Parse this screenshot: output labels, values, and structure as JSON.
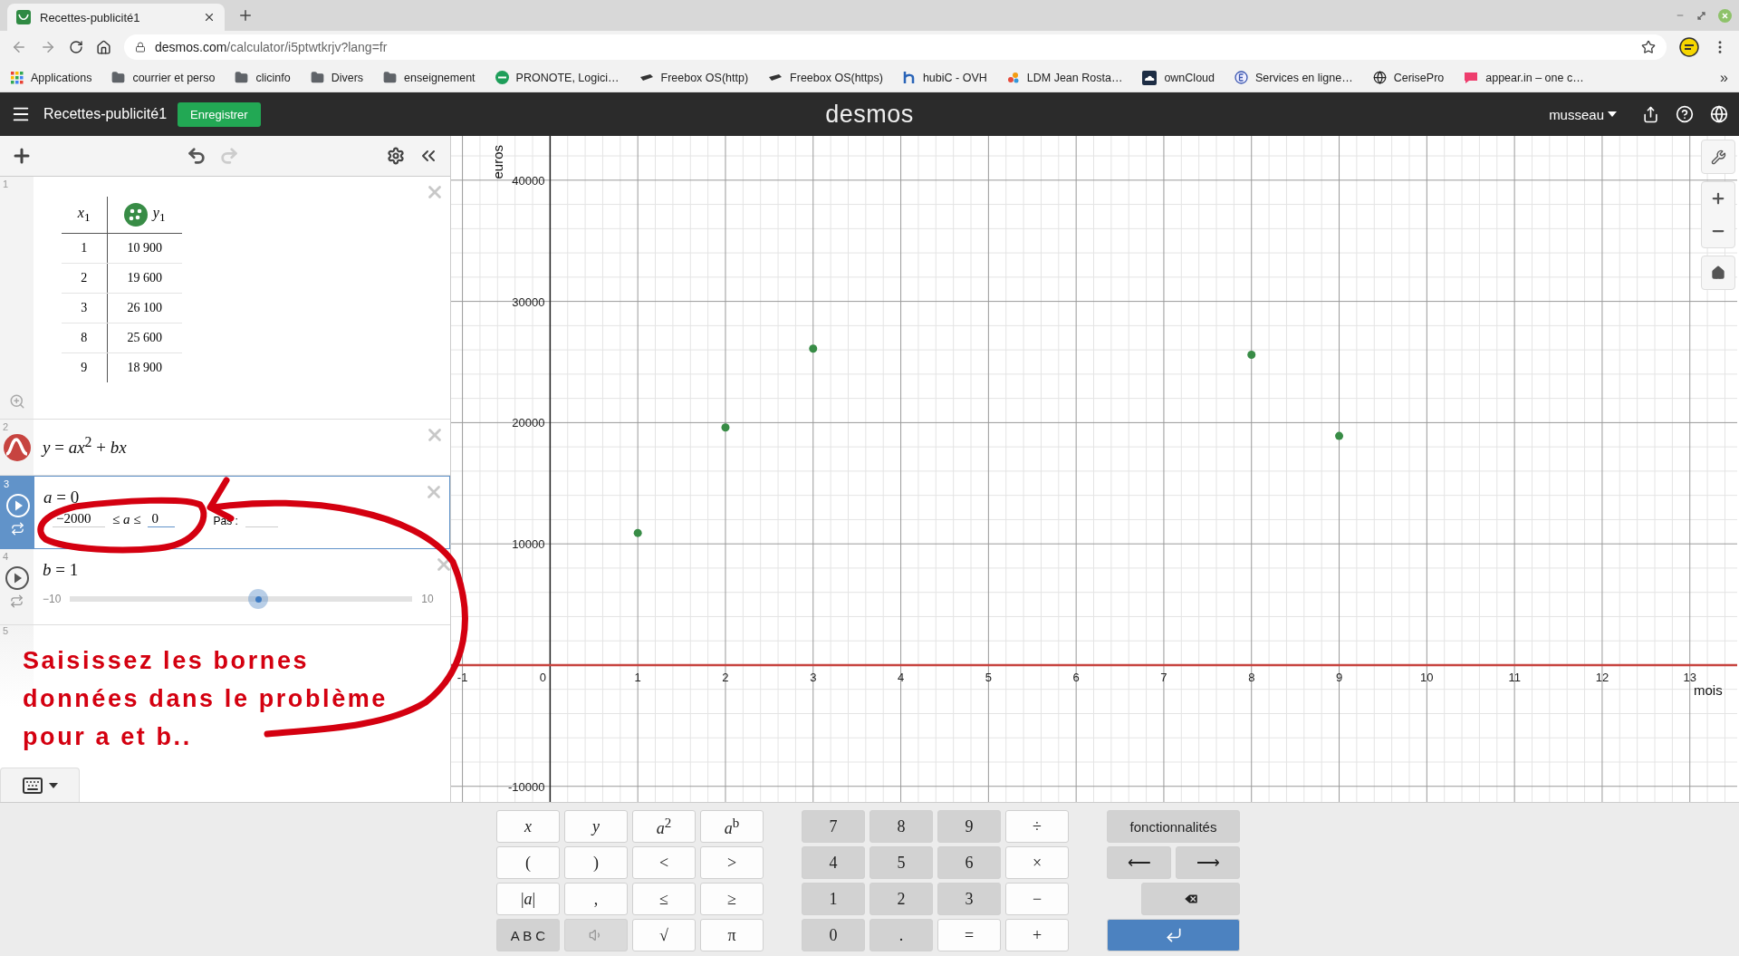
{
  "browser": {
    "tab": {
      "title": "Recettes-publicité1"
    },
    "url": {
      "host": "desmos.com",
      "path": "/calculator/i5ptwtkrjv?lang=fr"
    },
    "bookmarks": [
      {
        "label": "Applications",
        "kind": "apps"
      },
      {
        "label": "courrier et perso",
        "kind": "folder"
      },
      {
        "label": "clicinfo",
        "kind": "folder"
      },
      {
        "label": "Divers",
        "kind": "folder"
      },
      {
        "label": "enseignement",
        "kind": "folder"
      },
      {
        "label": "PRONOTE, Logici…",
        "kind": "badge"
      },
      {
        "label": "Freebox OS(http)",
        "kind": "device"
      },
      {
        "label": "Freebox OS(https)",
        "kind": "device"
      },
      {
        "label": "hubiC - OVH",
        "kind": "hook"
      },
      {
        "label": "LDM Jean Rosta…",
        "kind": "dots"
      },
      {
        "label": "ownCloud",
        "kind": "cloud"
      },
      {
        "label": "Services en ligne…",
        "kind": "ring"
      },
      {
        "label": "CerisePro",
        "kind": "globe"
      },
      {
        "label": "appear.in – one c…",
        "kind": "chat"
      }
    ],
    "overflow": "»"
  },
  "header": {
    "title": "Recettes-publicité1",
    "save": "Enregistrer",
    "logo": "desmos",
    "user": "musseau"
  },
  "expressions": [
    {
      "number": "1",
      "kind": "table",
      "color": "#388c46",
      "selected": false,
      "columns": [
        "*x*$_{1}$",
        "*y*$_{1}$"
      ],
      "rows": [
        [
          "1",
          "10 900"
        ],
        [
          "2",
          "19 600"
        ],
        [
          "3",
          "26 100"
        ],
        [
          "8",
          "25 600"
        ],
        [
          "9",
          "18 900"
        ]
      ]
    },
    {
      "number": "2",
      "kind": "formula",
      "color": "#c74440",
      "selected": false,
      "text": "*y* = *ax*$^{2}$ + *bx*"
    },
    {
      "number": "3",
      "kind": "slider",
      "selected": true,
      "expanded": true,
      "text": "*a* = 0",
      "min": "−2000",
      "relation": "≤ *a* ≤",
      "max": "0",
      "step_label": "Pas :"
    },
    {
      "number": "4",
      "kind": "slider",
      "selected": false,
      "expanded": false,
      "text": "*b* = 1",
      "min": "−10",
      "max": "10",
      "level": 0.55
    },
    {
      "number": "5",
      "kind": "empty",
      "selected": false
    }
  ],
  "annotation": {
    "text": "Saisissez les bornes données dans le problème pour a et b..",
    "color": "#d40010"
  },
  "graph": {
    "chart_data": {
      "type": "scatter",
      "grid": true,
      "xlabel": "mois",
      "ylabel": "euros",
      "x": [
        1,
        2,
        3,
        8,
        9
      ],
      "series": [
        {
          "color": "#388c46",
          "values": [
            10900,
            19600,
            26100,
            25600,
            18900
          ]
        }
      ],
      "xlim": [
        -1.13,
        13.54
      ],
      "ylim": [
        -11290,
        43650
      ],
      "xticks": [
        -1,
        0,
        1,
        2,
        3,
        4,
        5,
        6,
        7,
        8,
        9,
        10,
        11,
        12,
        13
      ],
      "yticks": [
        -10000,
        10000,
        20000,
        30000,
        40000
      ]
    }
  },
  "keypad": {
    "open": true,
    "groups": [
      {
        "keys": [
          {
            "label": "*x*",
            "dark": false,
            "kind": "math"
          },
          {
            "label": "*y*",
            "dark": false,
            "kind": "math"
          },
          {
            "label": "*a*$^{2}$",
            "dark": false,
            "kind": "math"
          },
          {
            "label": "*a*$^{b}$",
            "dark": false,
            "kind": "math"
          },
          {
            "label": "(",
            "dark": false,
            "kind": "math"
          },
          {
            "label": ")",
            "dark": false,
            "kind": "math"
          },
          {
            "label": "<",
            "dark": false,
            "kind": "math"
          },
          {
            "label": ">",
            "dark": false,
            "kind": "math"
          },
          {
            "label": "|*a*|",
            "dark": false,
            "kind": "math"
          },
          {
            "label": ",",
            "dark": false,
            "kind": "math"
          },
          {
            "label": "≤",
            "dark": false,
            "kind": "math"
          },
          {
            "label": "≥",
            "dark": false,
            "kind": "math"
          },
          {
            "label": "A B C",
            "dark": true,
            "kind": "word"
          },
          {
            "kind": "sound"
          },
          {
            "label": "√",
            "dark": false,
            "kind": "math"
          },
          {
            "label": "π",
            "dark": false,
            "kind": "math"
          }
        ]
      },
      {
        "keys": [
          {
            "label": "7",
            "dark": true,
            "kind": "math"
          },
          {
            "label": "8",
            "dark": true,
            "kind": "math"
          },
          {
            "label": "9",
            "dark": true,
            "kind": "math"
          },
          {
            "label": "÷",
            "dark": false,
            "kind": "math"
          },
          {
            "label": "4",
            "dark": true,
            "kind": "math"
          },
          {
            "label": "5",
            "dark": true,
            "kind": "math"
          },
          {
            "label": "6",
            "dark": true,
            "kind": "math"
          },
          {
            "label": "×",
            "dark": false,
            "kind": "math"
          },
          {
            "label": "1",
            "dark": true,
            "kind": "math"
          },
          {
            "label": "2",
            "dark": true,
            "kind": "math"
          },
          {
            "label": "3",
            "dark": true,
            "kind": "math"
          },
          {
            "label": "−",
            "dark": false,
            "kind": "math"
          },
          {
            "label": "0",
            "dark": true,
            "kind": "math"
          },
          {
            "label": ".",
            "dark": true,
            "kind": "math"
          },
          {
            "label": "=",
            "dark": false,
            "kind": "math"
          },
          {
            "label": "+",
            "dark": false,
            "kind": "math"
          }
        ]
      },
      {
        "keys": [
          {
            "label": "fonctionnalités",
            "dark": true,
            "kind": "word"
          },
          {
            "label": "⟵",
            "dark": true,
            "kind": "math"
          },
          {
            "label": "⟶",
            "dark": true,
            "kind": "math"
          },
          {
            "kind": "backspace"
          },
          {
            "kind": "enter"
          }
        ]
      }
    ]
  }
}
